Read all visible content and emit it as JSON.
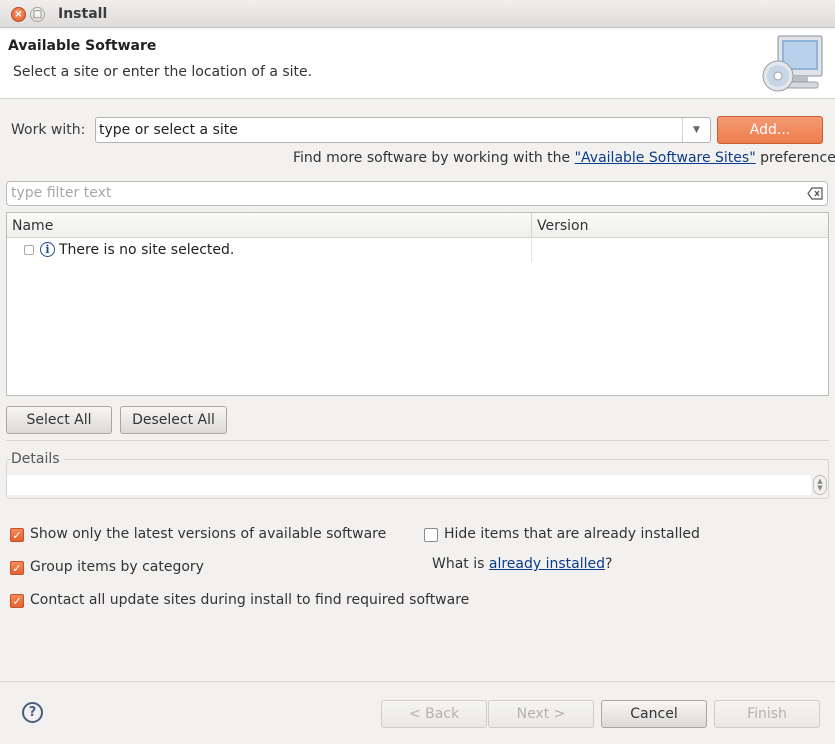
{
  "window": {
    "title": "Install"
  },
  "header": {
    "title": "Available Software",
    "description": "Select a site or enter the location of a site."
  },
  "work_with": {
    "label": "Work with:",
    "value": "type or select a site",
    "add_label": "Add...",
    "find_more_prefix": "Find more software by working with the ",
    "find_more_link": "\"Available Software Sites\"",
    "find_more_suffix": " preferences."
  },
  "filter": {
    "placeholder": "type filter text"
  },
  "table": {
    "columns": [
      "Name",
      "Version"
    ],
    "rows": [
      {
        "name": "There is no site selected.",
        "version": ""
      }
    ]
  },
  "buttons": {
    "select_all": "Select All",
    "deselect_all": "Deselect All"
  },
  "details": {
    "label": "Details"
  },
  "options": {
    "show_latest": {
      "label": "Show only the latest versions of available software",
      "checked": true
    },
    "group_by_category": {
      "label": "Group items by category",
      "checked": true
    },
    "contact_sites": {
      "label": "Contact all update sites during install to find required software",
      "checked": true
    },
    "hide_installed": {
      "label": "Hide items that are already installed",
      "checked": false
    },
    "what_is_prefix": "What is ",
    "what_is_link": "already installed",
    "what_is_suffix": "?"
  },
  "footer": {
    "back": "< Back",
    "next": "Next >",
    "cancel": "Cancel",
    "finish": "Finish"
  },
  "colors": {
    "accent": "#ee7d4d",
    "link": "#0b3c8c",
    "background": "#f2f1f0"
  }
}
